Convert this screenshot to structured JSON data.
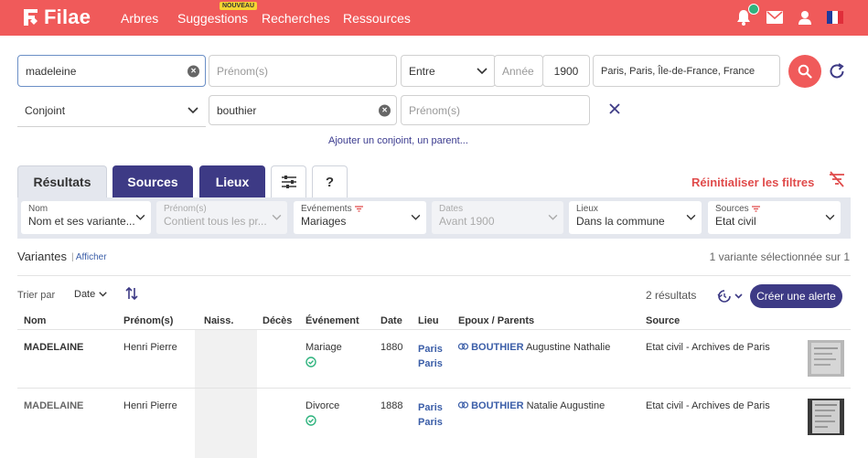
{
  "brand": {
    "name": "Filae",
    "header_color": "#f05a5a",
    "accent": "#3d3a85"
  },
  "nav": {
    "items": [
      {
        "label": "Arbres"
      },
      {
        "label": "Suggestions",
        "badge": "NOUVEAU"
      },
      {
        "label": "Recherches"
      },
      {
        "label": "Ressources"
      }
    ],
    "icons": [
      "bell-icon",
      "mail-icon",
      "user-icon",
      "french-flag-icon"
    ]
  },
  "search": {
    "nom_value": "madeleine",
    "prenom_placeholder": "Prénom(s)",
    "period_value": "Entre",
    "annee_placeholder": "Année",
    "annee_value": "1900",
    "lieu_value": "Paris, Paris, Île-de-France, France",
    "relation_value": "Conjoint",
    "conjoint_nom_value": "bouthier",
    "conjoint_prenom_placeholder": "Prénom(s)",
    "add_link": "Ajouter un conjoint, un parent..."
  },
  "tabs": {
    "results": "Résultats",
    "sources": "Sources",
    "lieux": "Lieux",
    "help": "?",
    "reset_filters": "Réinitialiser les filtres"
  },
  "filters": [
    {
      "label": "Nom",
      "value": "Nom et ses variante...",
      "disabled": false,
      "funnel": false
    },
    {
      "label": "Prénom(s)",
      "value": "Contient tous les pr...",
      "disabled": true,
      "funnel": false
    },
    {
      "label": "Evénements",
      "value": "Mariages",
      "disabled": false,
      "funnel": true
    },
    {
      "label": "Dates",
      "value": "Avant 1900",
      "disabled": true,
      "funnel": false
    },
    {
      "label": "Lieux",
      "value": "Dans la commune",
      "disabled": false,
      "funnel": false
    },
    {
      "label": "Sources",
      "value": "Etat civil",
      "disabled": false,
      "funnel": true
    }
  ],
  "variants": {
    "title": "Variantes",
    "show_link": "Afficher",
    "selected_text": "1 variante sélectionnée sur 1"
  },
  "sort": {
    "label": "Trier par",
    "value": "Date"
  },
  "results_count": "2 résultats",
  "create_alert": "Créer une alerte",
  "table": {
    "headers": {
      "nom": "Nom",
      "prenom": "Prénom(s)",
      "naiss": "Naiss.",
      "deces": "Décès",
      "evenement": "Événement",
      "date": "Date",
      "lieu": "Lieu",
      "epoux": "Epoux / Parents",
      "source": "Source"
    },
    "rows": [
      {
        "nom": "MADELAINE",
        "prenom": "Henri Pierre",
        "evenement": "Mariage",
        "date": "1880",
        "lieu_1": "Paris",
        "lieu_2": "Paris",
        "epoux_nom": "BOUTHIER",
        "epoux_prenom": "Augustine Nathalie",
        "source": "Etat civil - Archives de Paris"
      },
      {
        "nom": "MADELAINE",
        "prenom": "Henri Pierre",
        "evenement": "Divorce",
        "date": "1888",
        "lieu_1": "Paris",
        "lieu_2": "Paris",
        "epoux_nom": "BOUTHIER",
        "epoux_prenom": "Natalie Augustine",
        "source": "Etat civil - Archives de Paris"
      }
    ]
  }
}
